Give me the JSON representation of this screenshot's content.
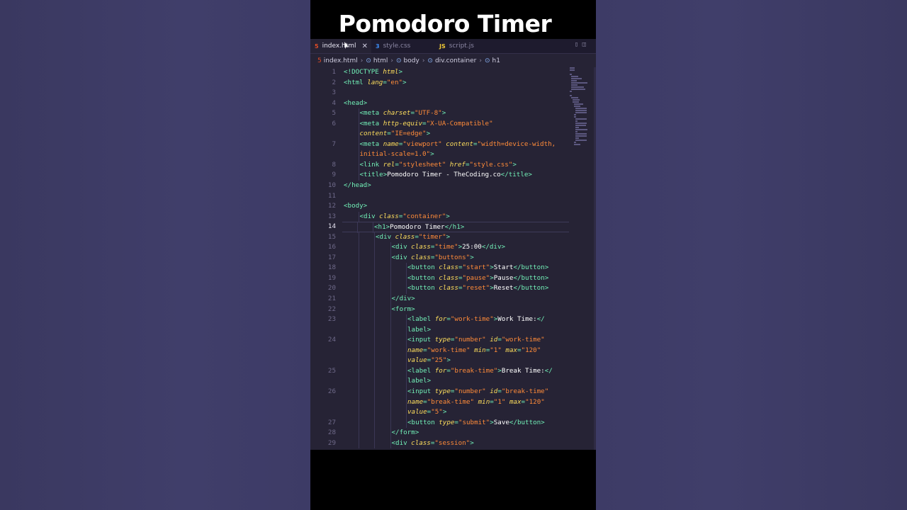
{
  "video": {
    "title": "Pomodoro Timer"
  },
  "tabs": [
    {
      "label": "index.html",
      "icon": "html-file-icon",
      "icon_glyph": "5",
      "icon_color": "#e44d26",
      "active": true
    },
    {
      "label": "style.css",
      "icon": "css-file-icon",
      "icon_glyph": "3",
      "icon_color": "#3e8ef7",
      "active": false
    },
    {
      "label": "script.js",
      "icon": "js-file-icon",
      "icon_glyph": "JS",
      "icon_color": "#f0c935",
      "active": false
    }
  ],
  "breadcrumb": [
    "index.html",
    "html",
    "body",
    "div.container",
    "h1"
  ],
  "current_line": 14,
  "colors": {
    "tag": "#72f1b8",
    "attribute": "#fede5d",
    "string": "#ff8b39",
    "text": "#ffffff",
    "background": "#262335"
  },
  "lines": [
    {
      "n": "1",
      "indent": 0,
      "parts": [
        [
          "t",
          "<!DOCTYPE "
        ],
        [
          "a",
          "html"
        ],
        [
          "t",
          ">"
        ]
      ]
    },
    {
      "n": "2",
      "indent": 0,
      "parts": [
        [
          "t",
          "<html "
        ],
        [
          "a",
          "lang"
        ],
        [
          "t",
          "="
        ],
        [
          "s",
          "\"en\""
        ],
        [
          "t",
          ">"
        ]
      ]
    },
    {
      "n": "3",
      "indent": 0,
      "parts": []
    },
    {
      "n": "4",
      "indent": 0,
      "parts": [
        [
          "t",
          "<head>"
        ]
      ]
    },
    {
      "n": "5",
      "indent": 1,
      "parts": [
        [
          "t",
          "<meta "
        ],
        [
          "a",
          "charset"
        ],
        [
          "t",
          "="
        ],
        [
          "s",
          "\"UTF-8\""
        ],
        [
          "t",
          ">"
        ]
      ]
    },
    {
      "n": "6",
      "indent": 1,
      "parts": [
        [
          "t",
          "<meta "
        ],
        [
          "a",
          "http-equiv"
        ],
        [
          "t",
          "="
        ],
        [
          "s",
          "\"X-UA-Compatible\""
        ]
      ]
    },
    {
      "n": "",
      "indent": 1,
      "parts": [
        [
          "a",
          "content"
        ],
        [
          "t",
          "="
        ],
        [
          "s",
          "\"IE=edge\""
        ],
        [
          "t",
          ">"
        ]
      ]
    },
    {
      "n": "7",
      "indent": 1,
      "parts": [
        [
          "t",
          "<meta "
        ],
        [
          "a",
          "name"
        ],
        [
          "t",
          "="
        ],
        [
          "s",
          "\"viewport\""
        ],
        [
          "tx",
          " "
        ],
        [
          "a",
          "content"
        ],
        [
          "t",
          "="
        ],
        [
          "s",
          "\"width=device-width,"
        ]
      ]
    },
    {
      "n": "",
      "indent": 1,
      "parts": [
        [
          "s",
          "initial-scale=1.0\""
        ],
        [
          "t",
          ">"
        ]
      ]
    },
    {
      "n": "8",
      "indent": 1,
      "parts": [
        [
          "t",
          "<link "
        ],
        [
          "a",
          "rel"
        ],
        [
          "t",
          "="
        ],
        [
          "s",
          "\"stylesheet\""
        ],
        [
          "tx",
          " "
        ],
        [
          "a",
          "href"
        ],
        [
          "t",
          "="
        ],
        [
          "s",
          "\"style.css\""
        ],
        [
          "t",
          ">"
        ]
      ]
    },
    {
      "n": "9",
      "indent": 1,
      "parts": [
        [
          "t",
          "<title>"
        ],
        [
          "tx",
          "Pomodoro Timer - TheCoding.co"
        ],
        [
          "t",
          "</title>"
        ]
      ]
    },
    {
      "n": "10",
      "indent": 0,
      "parts": [
        [
          "t",
          "</head>"
        ]
      ]
    },
    {
      "n": "11",
      "indent": 0,
      "parts": []
    },
    {
      "n": "12",
      "indent": 0,
      "parts": [
        [
          "t",
          "<body>"
        ]
      ]
    },
    {
      "n": "13",
      "indent": 1,
      "parts": [
        [
          "t",
          "<div "
        ],
        [
          "a",
          "class"
        ],
        [
          "t",
          "="
        ],
        [
          "s",
          "\"container\""
        ],
        [
          "t",
          ">"
        ]
      ]
    },
    {
      "n": "14",
      "indent": 2,
      "parts": [
        [
          "t",
          "<h1>"
        ],
        [
          "tx",
          "Pomodoro Timer"
        ],
        [
          "t",
          "</h1>"
        ]
      ]
    },
    {
      "n": "15",
      "indent": 2,
      "parts": [
        [
          "t",
          "<div "
        ],
        [
          "a",
          "class"
        ],
        [
          "t",
          "="
        ],
        [
          "s",
          "\"timer\""
        ],
        [
          "t",
          ">"
        ]
      ]
    },
    {
      "n": "16",
      "indent": 3,
      "parts": [
        [
          "t",
          "<div "
        ],
        [
          "a",
          "class"
        ],
        [
          "t",
          "="
        ],
        [
          "s",
          "\"time\""
        ],
        [
          "t",
          ">"
        ],
        [
          "tx",
          "25:00"
        ],
        [
          "t",
          "</div>"
        ]
      ]
    },
    {
      "n": "17",
      "indent": 3,
      "parts": [
        [
          "t",
          "<div "
        ],
        [
          "a",
          "class"
        ],
        [
          "t",
          "="
        ],
        [
          "s",
          "\"buttons\""
        ],
        [
          "t",
          ">"
        ]
      ]
    },
    {
      "n": "18",
      "indent": 4,
      "parts": [
        [
          "t",
          "<button "
        ],
        [
          "a",
          "class"
        ],
        [
          "t",
          "="
        ],
        [
          "s",
          "\"start\""
        ],
        [
          "t",
          ">"
        ],
        [
          "tx",
          "Start"
        ],
        [
          "t",
          "</button>"
        ]
      ]
    },
    {
      "n": "19",
      "indent": 4,
      "parts": [
        [
          "t",
          "<button "
        ],
        [
          "a",
          "class"
        ],
        [
          "t",
          "="
        ],
        [
          "s",
          "\"pause\""
        ],
        [
          "t",
          ">"
        ],
        [
          "tx",
          "Pause"
        ],
        [
          "t",
          "</button>"
        ]
      ]
    },
    {
      "n": "20",
      "indent": 4,
      "parts": [
        [
          "t",
          "<button "
        ],
        [
          "a",
          "class"
        ],
        [
          "t",
          "="
        ],
        [
          "s",
          "\"reset\""
        ],
        [
          "t",
          ">"
        ],
        [
          "tx",
          "Reset"
        ],
        [
          "t",
          "</button>"
        ]
      ]
    },
    {
      "n": "21",
      "indent": 3,
      "parts": [
        [
          "t",
          "</div>"
        ]
      ]
    },
    {
      "n": "22",
      "indent": 3,
      "parts": [
        [
          "t",
          "<form>"
        ]
      ]
    },
    {
      "n": "23",
      "indent": 4,
      "parts": [
        [
          "t",
          "<label "
        ],
        [
          "a",
          "for"
        ],
        [
          "t",
          "="
        ],
        [
          "s",
          "\"work-time\""
        ],
        [
          "t",
          ">"
        ],
        [
          "tx",
          "Work Time:"
        ],
        [
          "t",
          "</"
        ]
      ]
    },
    {
      "n": "",
      "indent": 4,
      "parts": [
        [
          "t",
          "label>"
        ]
      ]
    },
    {
      "n": "24",
      "indent": 4,
      "parts": [
        [
          "t",
          "<input "
        ],
        [
          "a",
          "type"
        ],
        [
          "t",
          "="
        ],
        [
          "s",
          "\"number\""
        ],
        [
          "tx",
          " "
        ],
        [
          "a",
          "id"
        ],
        [
          "t",
          "="
        ],
        [
          "s",
          "\"work-time\""
        ]
      ]
    },
    {
      "n": "",
      "indent": 4,
      "parts": [
        [
          "a",
          "name"
        ],
        [
          "t",
          "="
        ],
        [
          "s",
          "\"work-time\""
        ],
        [
          "tx",
          " "
        ],
        [
          "a",
          "min"
        ],
        [
          "t",
          "="
        ],
        [
          "s",
          "\"1\""
        ],
        [
          "tx",
          " "
        ],
        [
          "a",
          "max"
        ],
        [
          "t",
          "="
        ],
        [
          "s",
          "\"120\""
        ]
      ]
    },
    {
      "n": "",
      "indent": 4,
      "parts": [
        [
          "a",
          "value"
        ],
        [
          "t",
          "="
        ],
        [
          "s",
          "\"25\""
        ],
        [
          "t",
          ">"
        ]
      ]
    },
    {
      "n": "25",
      "indent": 4,
      "parts": [
        [
          "t",
          "<label "
        ],
        [
          "a",
          "for"
        ],
        [
          "t",
          "="
        ],
        [
          "s",
          "\"break-time\""
        ],
        [
          "t",
          ">"
        ],
        [
          "tx",
          "Break Time:"
        ],
        [
          "t",
          "</"
        ]
      ]
    },
    {
      "n": "",
      "indent": 4,
      "parts": [
        [
          "t",
          "label>"
        ]
      ]
    },
    {
      "n": "26",
      "indent": 4,
      "parts": [
        [
          "t",
          "<input "
        ],
        [
          "a",
          "type"
        ],
        [
          "t",
          "="
        ],
        [
          "s",
          "\"number\""
        ],
        [
          "tx",
          " "
        ],
        [
          "a",
          "id"
        ],
        [
          "t",
          "="
        ],
        [
          "s",
          "\"break-time\""
        ]
      ]
    },
    {
      "n": "",
      "indent": 4,
      "parts": [
        [
          "a",
          "name"
        ],
        [
          "t",
          "="
        ],
        [
          "s",
          "\"break-time\""
        ],
        [
          "tx",
          " "
        ],
        [
          "a",
          "min"
        ],
        [
          "t",
          "="
        ],
        [
          "s",
          "\"1\""
        ],
        [
          "tx",
          " "
        ],
        [
          "a",
          "max"
        ],
        [
          "t",
          "="
        ],
        [
          "s",
          "\"120\""
        ]
      ]
    },
    {
      "n": "",
      "indent": 4,
      "parts": [
        [
          "a",
          "value"
        ],
        [
          "t",
          "="
        ],
        [
          "s",
          "\"5\""
        ],
        [
          "t",
          ">"
        ]
      ]
    },
    {
      "n": "27",
      "indent": 4,
      "parts": [
        [
          "t",
          "<button "
        ],
        [
          "a",
          "type"
        ],
        [
          "t",
          "="
        ],
        [
          "s",
          "\"submit\""
        ],
        [
          "t",
          ">"
        ],
        [
          "tx",
          "Save"
        ],
        [
          "t",
          "</button>"
        ]
      ]
    },
    {
      "n": "28",
      "indent": 3,
      "parts": [
        [
          "t",
          "</form>"
        ]
      ]
    },
    {
      "n": "29",
      "indent": 3,
      "parts": [
        [
          "t",
          "<div "
        ],
        [
          "a",
          "class"
        ],
        [
          "t",
          "="
        ],
        [
          "s",
          "\"session\""
        ],
        [
          "t",
          ">"
        ]
      ]
    }
  ]
}
